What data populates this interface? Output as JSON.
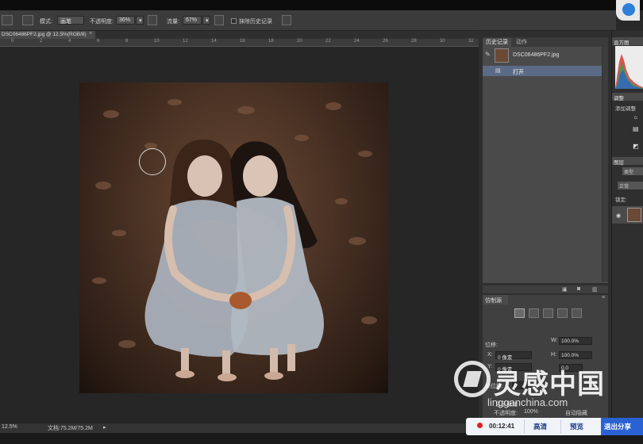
{
  "options_bar": {
    "mode_label": "模式:",
    "mode_value": "画笔",
    "opacity_label": "不透明度:",
    "opacity_value": "36%",
    "flow_label": "流量:",
    "flow_value": "67%",
    "history_label": "抹除历史记录"
  },
  "document": {
    "tab_title": "DSC06486PF2.jpg @ 12.5%(RGB/8)",
    "close": "×",
    "ruler_ticks": [
      "0",
      "2",
      "4",
      "6",
      "8",
      "10",
      "12",
      "14",
      "16",
      "18",
      "20",
      "22",
      "24",
      "26",
      "28",
      "30",
      "32"
    ],
    "zoom": "12.5%",
    "info": "文档:75.2M/75.2M",
    "info_arrow": "▸"
  },
  "history_panel": {
    "tabs": [
      "历史记录",
      "动作"
    ],
    "snapshot_name": "DSC06486PF2.jpg",
    "steps": [
      "打开"
    ]
  },
  "clone_panel": {
    "tab": "仿制源",
    "offset_label": "位移:",
    "x_label": "X:",
    "x_value": "0 像素",
    "y_label": "Y:",
    "y_value": "0 像素",
    "w_label": "W:",
    "w_value": "100.0%",
    "h_label": "H:",
    "h_value": "100.0%",
    "angle_value": "0.0",
    "frame_label": "帧位移:",
    "frame_value": "0",
    "show_overlay_label": "显示叠加",
    "opacity_label": "不透明度:",
    "opacity_value": "100%",
    "auto_hide_label": "自动隐藏"
  },
  "right_panels": {
    "navigator_tab": "直方图",
    "adjust_tab": "调整",
    "adjust_label": "添加调整",
    "layers_tab": "图层",
    "layer_kind": "类型",
    "layer_blend": "正常",
    "layer_lock": "锁定:"
  },
  "watermark": {
    "text": "灵感中国",
    "url": "lingganchina.com"
  },
  "recording": {
    "time": "00:12:41",
    "quality": "高清",
    "preview": "预览",
    "exit": "退出分享"
  },
  "colors": {
    "accent_selection": "#5b6a85",
    "record_red": "#e0201e",
    "share_blue": "#2b62d3"
  }
}
